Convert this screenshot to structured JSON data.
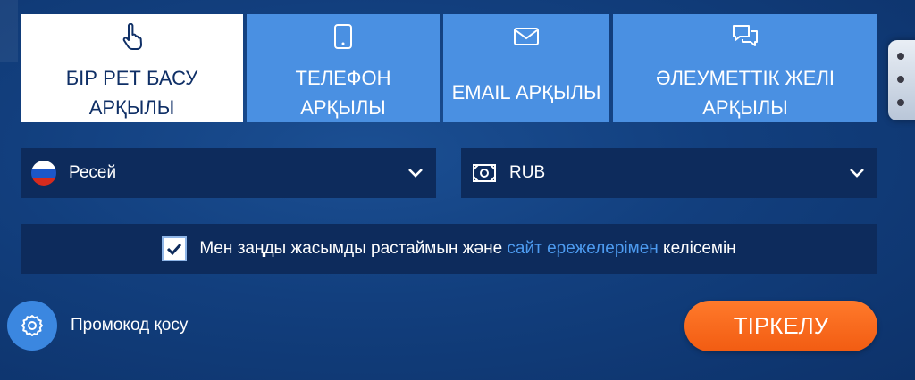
{
  "tabs": [
    {
      "label_line1": "БІР РЕТ БАСУ",
      "label_line2": "АРҚЫЛЫ",
      "icon": "pointer-hand-icon",
      "active": true
    },
    {
      "label_line1": "ТЕЛЕФОН",
      "label_line2": "АРҚЫЛЫ",
      "icon": "phone-icon",
      "active": false
    },
    {
      "label_line1": "EMAIL АРҚЫЛЫ",
      "label_line2": "",
      "icon": "envelope-icon",
      "active": false
    },
    {
      "label_line1": "ӘЛЕУМЕТТІК ЖЕЛІ",
      "label_line2": "АРҚЫЛЫ",
      "icon": "chat-bubbles-icon",
      "active": false
    }
  ],
  "country": {
    "value": "Ресей",
    "icon": "russia-flag-icon"
  },
  "currency": {
    "value": "RUB",
    "icon": "banknote-icon"
  },
  "agreement": {
    "checked": true,
    "text_before": "Мен заңды жасымды растаймын және ",
    "link_text": "сайт ережелерімен",
    "text_after": " келісемін"
  },
  "promo": {
    "label": "Промокод қосу",
    "icon": "gear-icon"
  },
  "register": {
    "label": "ТІРКЕЛУ"
  },
  "colors": {
    "tab": "#4a90e2",
    "tab_active": "#ffffff",
    "field": "#0d2b5c",
    "link": "#4d9bf0",
    "accent": "#f25c12"
  }
}
